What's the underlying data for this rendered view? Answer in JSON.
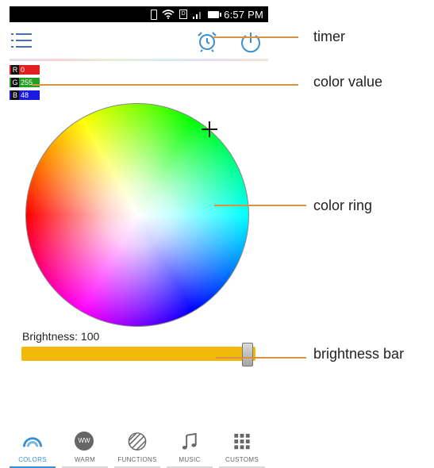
{
  "status_bar": {
    "time": "6:57 PM",
    "sim_label": "D"
  },
  "rgb": [
    {
      "channel": "R",
      "value": "0",
      "color": "#e02020"
    },
    {
      "channel": "G",
      "value": "255",
      "color": "#22a022"
    },
    {
      "channel": "B",
      "value": "48",
      "color": "#1a1ae0"
    }
  ],
  "brightness": {
    "label": "Brightness: 100",
    "level": 1.0,
    "fill_color": "#f2b90b"
  },
  "annotations": {
    "timer": "timer",
    "color_value": "color value",
    "color_ring": "color ring",
    "brightness_bar": "brightness bar"
  },
  "nav": {
    "items": [
      {
        "label": "COLORS",
        "icon": "rainbow-icon",
        "active": true
      },
      {
        "label": "WARM",
        "icon": "ww-icon",
        "active": false,
        "icon_text": "WW"
      },
      {
        "label": "FUNCTIONS",
        "icon": "striped-circle-icon",
        "active": false
      },
      {
        "label": "MUSIC",
        "icon": "music-note-icon",
        "active": false
      },
      {
        "label": "CUSTOMS",
        "icon": "grid-icon",
        "active": false
      }
    ]
  },
  "accent_color": "#3a8fd1",
  "annotation_line_color": "#d9923f"
}
